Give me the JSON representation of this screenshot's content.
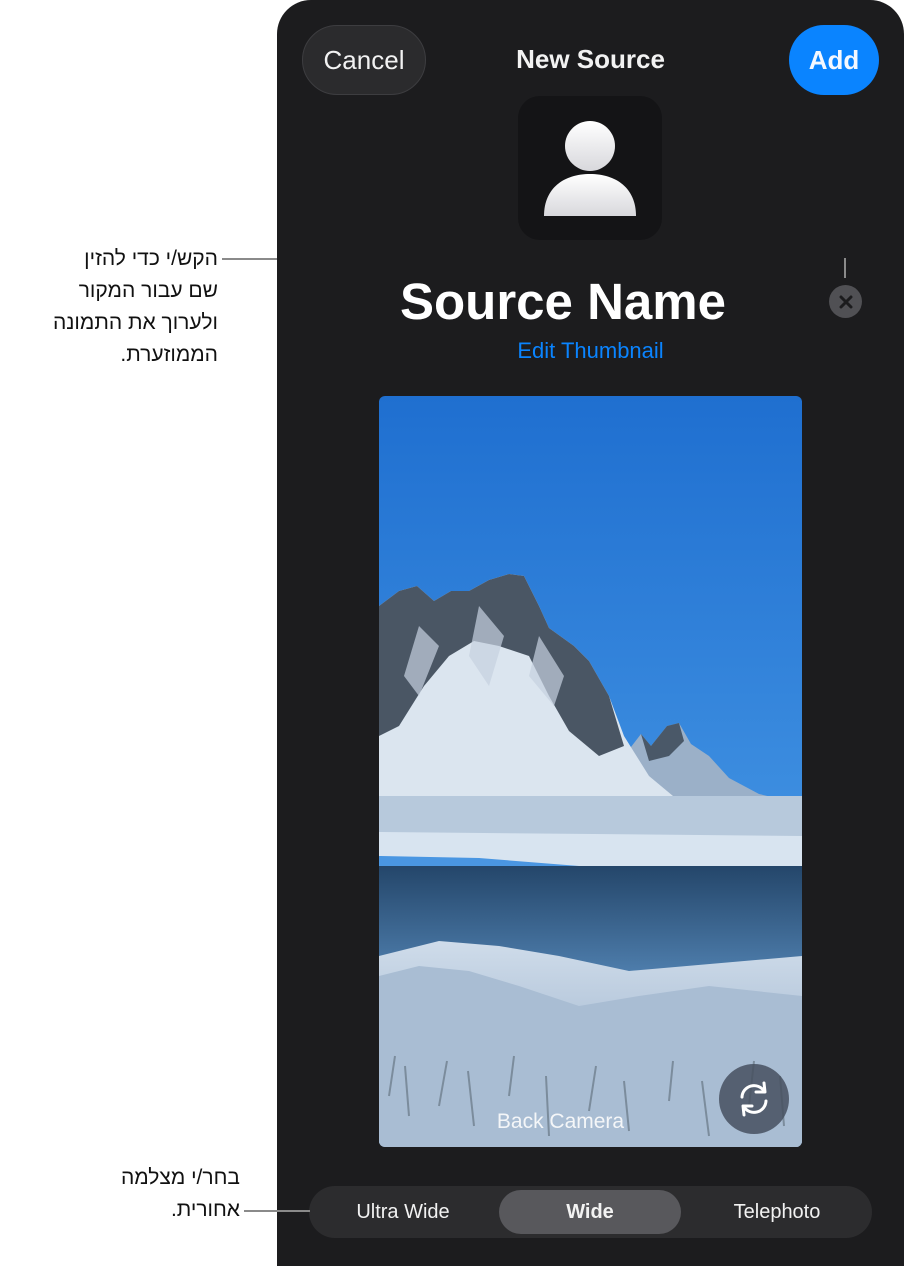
{
  "callouts": {
    "name_lines": [
      "הקש/י כדי להזין",
      "שם עבור המקור",
      "ולערוך את התמונה",
      "הממוזערת."
    ],
    "camera_lines": [
      "בחר/י מצלמה",
      "אחורית."
    ]
  },
  "header": {
    "cancel_label": "Cancel",
    "title": "New Source",
    "add_label": "Add"
  },
  "source": {
    "name": "Source Name",
    "edit_thumbnail_label": "Edit Thumbnail"
  },
  "preview": {
    "camera_label": "Back Camera"
  },
  "lenses": [
    {
      "label": "Ultra Wide",
      "selected": false
    },
    {
      "label": "Wide",
      "selected": true
    },
    {
      "label": "Telephoto",
      "selected": false
    }
  ],
  "icons": {
    "avatar": "person-icon",
    "clear": "clear-x-icon",
    "flip": "flip-camera-icon"
  },
  "colors": {
    "accent": "#0a84ff",
    "panel": "#1c1c1e"
  }
}
